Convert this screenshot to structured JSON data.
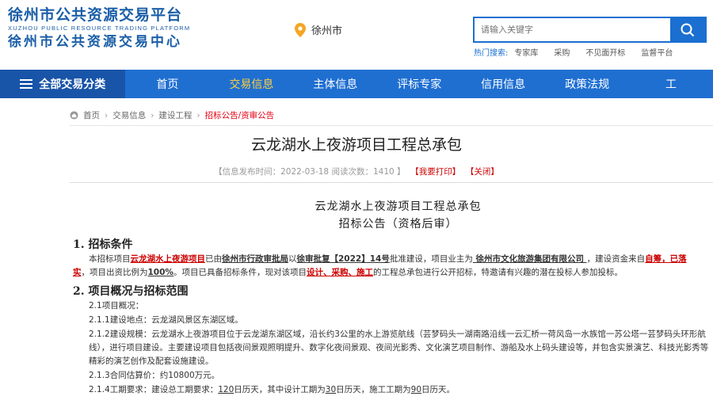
{
  "header": {
    "logo_cn1": "徐州市公共资源交易平台",
    "logo_en": "XUZHOU PUBLIC RESOURCE TRADING PLATFORM",
    "logo_cn2": "徐州市公共资源交易中心",
    "city": "徐州市",
    "search_placeholder": "请输入关键字",
    "hot_label": "热门搜索:",
    "hot_items": [
      "专家库",
      "采购",
      "不见面开标",
      "监督平台"
    ]
  },
  "nav": {
    "all_label": "全部交易分类",
    "items": [
      "首页",
      "交易信息",
      "主体信息",
      "评标专家",
      "信用信息",
      "政策法规",
      "工"
    ],
    "active_index": 1
  },
  "breadcrumb": [
    "首页",
    "交易信息",
    "建设工程",
    "招标公告/资审公告"
  ],
  "article": {
    "title": "云龙湖水上夜游项目工程总承包",
    "meta_prefix": "【信息发布时间：",
    "meta_date": "2022-03-18",
    "meta_views_label": "阅读次数：",
    "meta_views": "1410",
    "meta_suffix": "】",
    "print_btn": "【我要打印】",
    "close_btn": "【关闭】",
    "doc_title": "云龙湖水上夜游项目工程总承包",
    "doc_subtitle": "招标公告（资格后审）",
    "sec1_title": "1. 招标条件",
    "sec1_p_a": "本招标项目",
    "sec1_p_proj": "云龙湖水上夜游项目",
    "sec1_p_b": "已由",
    "sec1_p_auth": "徐州市行政审批局",
    "sec1_p_c": "以",
    "sec1_p_doc": "徐审批复【2022】14号",
    "sec1_p_d": "批准建设，项目业主为",
    "sec1_p_owner": "  徐州市文化旅游集团有限公司  ",
    "sec1_p_e": "，建设资金来自",
    "sec1_p_fund": "自筹，已落实",
    "sec1_p_f": "，项目出资比例为",
    "sec1_p_ratio": "100%",
    "sec1_p_g": "。项目已具备招标条件，现对该项目",
    "sec1_p_scope": "设计、采购、施工",
    "sec1_p_h": "的工程总承包进行公开招标，特邀请有兴趣的潜在投标人参加投标。",
    "sec2_title": "2. 项目概况与招标范围",
    "l1": "2.1项目概况：",
    "l2": "2.1.1建设地点：云龙湖风景区东湖区域。",
    "l3": "2.1.2建设规模：云龙湖水上夜游项目位于云龙湖东湖区域，沿长约3公里的水上游览航线（芸梦码头一湖南路沿线一云汇桥一荷风岛一水族馆一苏公塔一芸梦码头环形航线），进行项目建设。主要建设项目包括夜间景观照明提升、数字化夜间景观、夜间光影秀、文化演艺项目制作、游船及水上码头建设等，并包含实景演艺、科技光影秀等精彩的演艺创作及配套设施建设。",
    "l4": "2.1.3合同估算价：约10800万元。",
    "l5_a": "2.1.4工期要求：建设总工期要求：",
    "l5_total": "120",
    "l5_b": "日历天，其中设计工期为",
    "l5_design": "30",
    "l5_c": "日历天，施工工期为",
    "l5_build": "90",
    "l5_d": "日历天。"
  },
  "colors": {
    "brand": "#1a5ea8",
    "nav": "#1f6fd1",
    "nav_active": "#ffcf3f",
    "accent_red": "#c00"
  }
}
